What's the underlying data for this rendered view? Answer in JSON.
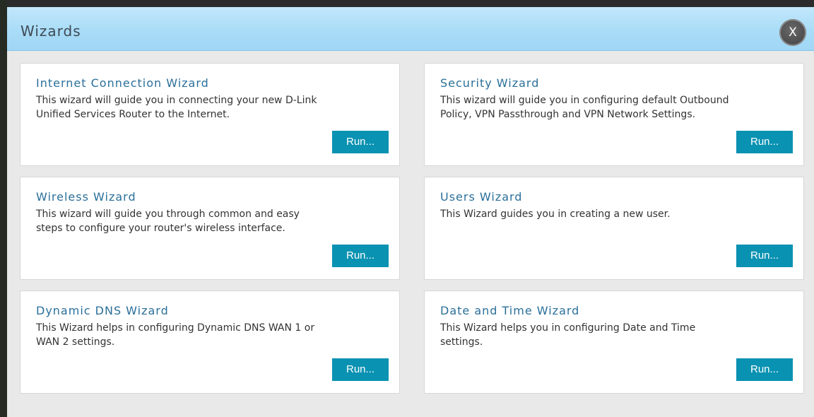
{
  "dialog": {
    "title": "Wizards",
    "close_label": "X"
  },
  "cards": [
    {
      "title": "Internet Connection Wizard",
      "description": "This wizard will guide you in connecting your new D-Link Unified Services Router to the Internet.",
      "button": "Run..."
    },
    {
      "title": "Security Wizard",
      "description": "This wizard will guide you in configuring default Outbound Policy, VPN Passthrough and VPN Network Settings.",
      "button": "Run..."
    },
    {
      "title": "Wireless Wizard",
      "description": "This wizard will guide you through common and easy steps to configure your router's wireless interface.",
      "button": "Run..."
    },
    {
      "title": "Users Wizard",
      "description": "This Wizard guides you in creating a new user.",
      "button": "Run..."
    },
    {
      "title": "Dynamic DNS Wizard",
      "description": "This Wizard helps in configuring Dynamic DNS WAN 1 or WAN 2 settings.",
      "button": "Run..."
    },
    {
      "title": "Date and Time Wizard",
      "description": "This Wizard helps you in configuring Date and Time settings.",
      "button": "Run..."
    }
  ],
  "colors": {
    "header": "#a9dcf7",
    "title_text": "#2a6f9a",
    "button": "#0a92b2",
    "background": "#e9e9e9"
  }
}
